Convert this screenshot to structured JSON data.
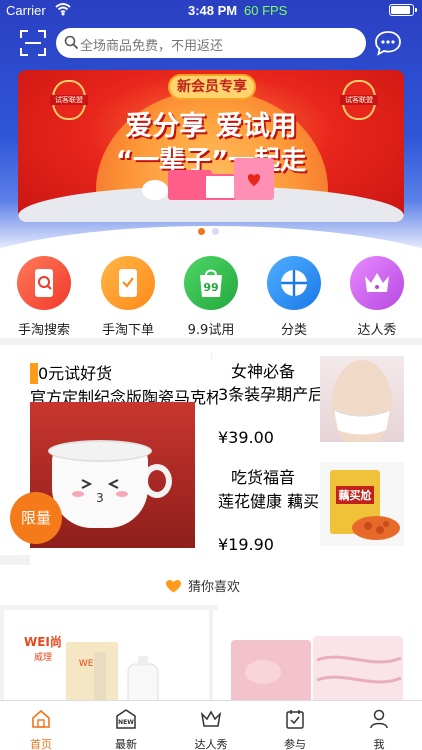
{
  "status_bar": {
    "carrier": "Carrier",
    "time": "3:48 PM",
    "fps": "60 FPS",
    "battery_level": 0.95
  },
  "search": {
    "placeholder": "全场商品免费，不用返还"
  },
  "banner": {
    "tag": "新会员专享",
    "line1": "爱分享 爱试用",
    "line2": "“一辈子”一起走",
    "lantern_text": "试客联盟",
    "page_index": 0,
    "page_count": 2
  },
  "categories": [
    {
      "label": "手淘搜索",
      "icon": "taobao-search-icon",
      "color": "#f4523c"
    },
    {
      "label": "手淘下单",
      "icon": "taobao-order-icon",
      "color": "#ff9a2a"
    },
    {
      "label": "9.9试用",
      "icon": "nine-nine-trial-icon",
      "color": "#36c14f",
      "badge": "99"
    },
    {
      "label": "分类",
      "icon": "category-grid-icon",
      "color": "#2a8cf0"
    },
    {
      "label": "达人秀",
      "icon": "crown-icon",
      "color": "#c85ce8"
    }
  ],
  "promo": {
    "left": {
      "title": "0元试好货",
      "subtitle": "官方定制纪念版陶瓷马克杯",
      "badge": "限量"
    },
    "right_top": {
      "title": "女神必备",
      "subtitle": "3条装孕期产后都...",
      "price": "¥39.00"
    },
    "right_bottom": {
      "title": "吃货福音",
      "subtitle": "莲花健康 藕买尬...",
      "price": "¥19.90",
      "product_text": "藕买尬"
    }
  },
  "guess": {
    "label": "猜你喜欢"
  },
  "products": [
    {
      "brand": "WEI尚",
      "brand_sub": "威理"
    },
    {
      "brand": ""
    }
  ],
  "tabbar": [
    {
      "label": "首页",
      "icon": "home-icon",
      "active": true
    },
    {
      "label": "最新",
      "icon": "new-icon",
      "active": false,
      "icon_text": "NEW"
    },
    {
      "label": "达人秀",
      "icon": "crown-icon",
      "active": false
    },
    {
      "label": "参与",
      "icon": "calendar-check-icon",
      "active": false
    },
    {
      "label": "我",
      "icon": "person-icon",
      "active": false
    }
  ],
  "colors": {
    "accent": "#f2731a",
    "promo_title": "#f35a2a",
    "hero_blue": "#2f56d8"
  }
}
